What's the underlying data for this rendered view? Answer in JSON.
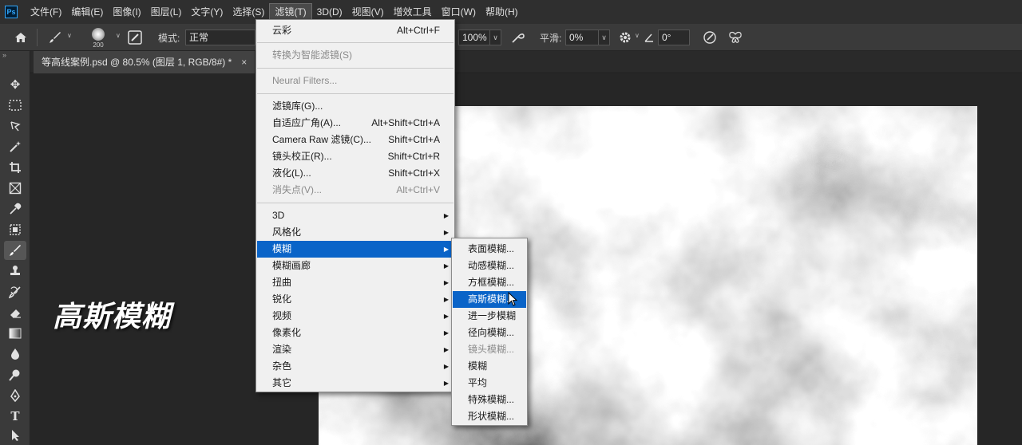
{
  "menubar": {
    "logo": "Ps",
    "items": [
      "文件(F)",
      "编辑(E)",
      "图像(I)",
      "图层(L)",
      "文字(Y)",
      "选择(S)",
      "滤镜(T)",
      "3D(D)",
      "视图(V)",
      "增效工具",
      "窗口(W)",
      "帮助(H)"
    ],
    "active_index": 6
  },
  "options": {
    "brush_size": "200",
    "mode_label": "模式:",
    "mode_value": "正常",
    "flow_value": "100%",
    "smooth_label": "平滑:",
    "smooth_value": "0%",
    "angle_value": "0°"
  },
  "document": {
    "tab_title": "等高线案例.psd @ 80.5% (图层 1, RGB/8#) *",
    "close": "×"
  },
  "overlay": {
    "title": "高斯模糊"
  },
  "filter_menu": {
    "items": [
      {
        "label": "云彩",
        "shortcut": "Alt+Ctrl+F",
        "disabled": false
      },
      {
        "label": "转换为智能滤镜(S)",
        "shortcut": "",
        "disabled": true
      },
      {
        "label": "Neural Filters...",
        "shortcut": "",
        "disabled": true
      },
      {
        "label": "滤镜库(G)...",
        "shortcut": "",
        "disabled": false
      },
      {
        "label": "自适应广角(A)...",
        "shortcut": "Alt+Shift+Ctrl+A",
        "disabled": false
      },
      {
        "label": "Camera Raw 滤镜(C)...",
        "shortcut": "Shift+Ctrl+A",
        "disabled": false
      },
      {
        "label": "镜头校正(R)...",
        "shortcut": "Shift+Ctrl+R",
        "disabled": false
      },
      {
        "label": "液化(L)...",
        "shortcut": "Shift+Ctrl+X",
        "disabled": false
      },
      {
        "label": "消失点(V)...",
        "shortcut": "Alt+Ctrl+V",
        "disabled": true
      },
      {
        "label": "3D",
        "shortcut": "",
        "disabled": false,
        "submenu": true
      },
      {
        "label": "风格化",
        "shortcut": "",
        "disabled": false,
        "submenu": true
      },
      {
        "label": "模糊",
        "shortcut": "",
        "disabled": false,
        "submenu": true,
        "highlighted": true
      },
      {
        "label": "模糊画廊",
        "shortcut": "",
        "disabled": false,
        "submenu": true
      },
      {
        "label": "扭曲",
        "shortcut": "",
        "disabled": false,
        "submenu": true
      },
      {
        "label": "锐化",
        "shortcut": "",
        "disabled": false,
        "submenu": true
      },
      {
        "label": "视频",
        "shortcut": "",
        "disabled": false,
        "submenu": true
      },
      {
        "label": "像素化",
        "shortcut": "",
        "disabled": false,
        "submenu": true
      },
      {
        "label": "渲染",
        "shortcut": "",
        "disabled": false,
        "submenu": true
      },
      {
        "label": "杂色",
        "shortcut": "",
        "disabled": false,
        "submenu": true
      },
      {
        "label": "其它",
        "shortcut": "",
        "disabled": false,
        "submenu": true
      }
    ]
  },
  "blur_submenu": {
    "items": [
      {
        "label": "表面模糊...",
        "disabled": false
      },
      {
        "label": "动感模糊...",
        "disabled": false
      },
      {
        "label": "方框模糊...",
        "disabled": false
      },
      {
        "label": "高斯模糊...",
        "disabled": false,
        "highlighted": true
      },
      {
        "label": "进一步模糊",
        "disabled": false
      },
      {
        "label": "径向模糊...",
        "disabled": false
      },
      {
        "label": "镜头模糊...",
        "disabled": true
      },
      {
        "label": "模糊",
        "disabled": false
      },
      {
        "label": "平均",
        "disabled": false
      },
      {
        "label": "特殊模糊...",
        "disabled": false
      },
      {
        "label": "形状模糊...",
        "disabled": false
      }
    ]
  },
  "colors": {
    "highlight": "#0a64c8",
    "panel": "#3a3a3a",
    "menu_bg": "#f0f0f0"
  }
}
